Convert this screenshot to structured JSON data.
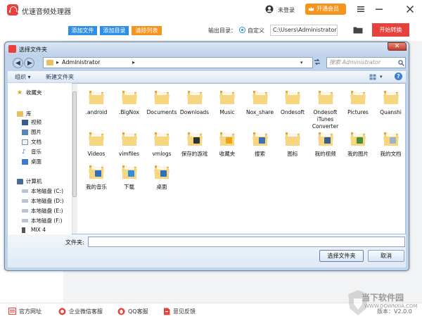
{
  "app": {
    "title": "优速音频处理器",
    "login_text": "未登录",
    "vip_label": "开通会员",
    "accent_color": "#e8413b"
  },
  "toolbar": {
    "add_file": "添加文件",
    "add_folder": "添加目录",
    "clear_list": "清除列表",
    "output_label": "输出目录：",
    "custom_label": "自定义",
    "output_path": "C:\\Users\\Administrator",
    "start_label": "开始转换"
  },
  "dialog": {
    "title": "选择文件夹",
    "address": "Administrator",
    "search_placeholder": "搜索 Administrator",
    "organize": "组织 ▾",
    "new_folder": "新建文件夹",
    "folder_label": "文件夹:",
    "folder_value": "",
    "select_button": "选择文件夹",
    "cancel_button": "取消",
    "nav": {
      "favorites": "收藏夹",
      "library": "库",
      "videos": "视频",
      "pictures": "图片",
      "documents": "文档",
      "music": "音乐",
      "desktop": "桌面",
      "computer": "计算机",
      "drive_c": "本地磁盘 (C:)",
      "drive_d": "本地磁盘 (D:)",
      "drive_e": "本地磁盘 (E:)",
      "drive_f": "本地磁盘 (F:)",
      "mix4": "MIX 4"
    },
    "files": [
      {
        "name": ".android",
        "icon": "folder-icon"
      },
      {
        "name": ".BigNox",
        "icon": "folder-icon"
      },
      {
        "name": "Documents",
        "icon": "folder-icon"
      },
      {
        "name": "Downloads",
        "icon": "folder-icon"
      },
      {
        "name": "Music",
        "icon": "folder-icon"
      },
      {
        "name": "Nox_share",
        "icon": "folder-icon"
      },
      {
        "name": "Ondesoft",
        "icon": "folder-icon"
      },
      {
        "name": "Ondesoft iTunes Converter",
        "icon": "folder-icon"
      },
      {
        "name": "Pictures",
        "icon": "folder-icon"
      },
      {
        "name": "Quanshi",
        "icon": "folder-icon"
      },
      {
        "name": "Videos",
        "icon": "folder-icon"
      },
      {
        "name": "vimfiles",
        "icon": "folder-icon"
      },
      {
        "name": "vmlogs",
        "icon": "folder-icon"
      },
      {
        "name": "保存的游戏",
        "icon": "saved-games-folder-icon"
      },
      {
        "name": "收藏夹",
        "icon": "favorites-folder-icon"
      },
      {
        "name": "搜索",
        "icon": "search-folder-icon"
      },
      {
        "name": "图标",
        "icon": "folder-icon"
      },
      {
        "name": "我的视频",
        "icon": "videos-folder-icon"
      },
      {
        "name": "我的图片",
        "icon": "pictures-folder-icon"
      },
      {
        "name": "我的文档",
        "icon": "documents-folder-icon"
      },
      {
        "name": "我的音乐",
        "icon": "music-folder-icon"
      },
      {
        "name": "下载",
        "icon": "downloads-folder-icon"
      },
      {
        "name": "桌面",
        "icon": "desktop-folder-icon"
      }
    ]
  },
  "footer": {
    "website": "官方网址",
    "wechat": "企业微信客服",
    "qq": "QQ客服",
    "feedback": "意见反馈",
    "version": "版本：V2.0.0"
  },
  "watermark": {
    "text": "当下软件园",
    "sub": "WWW.DOWNXIA.COM"
  }
}
